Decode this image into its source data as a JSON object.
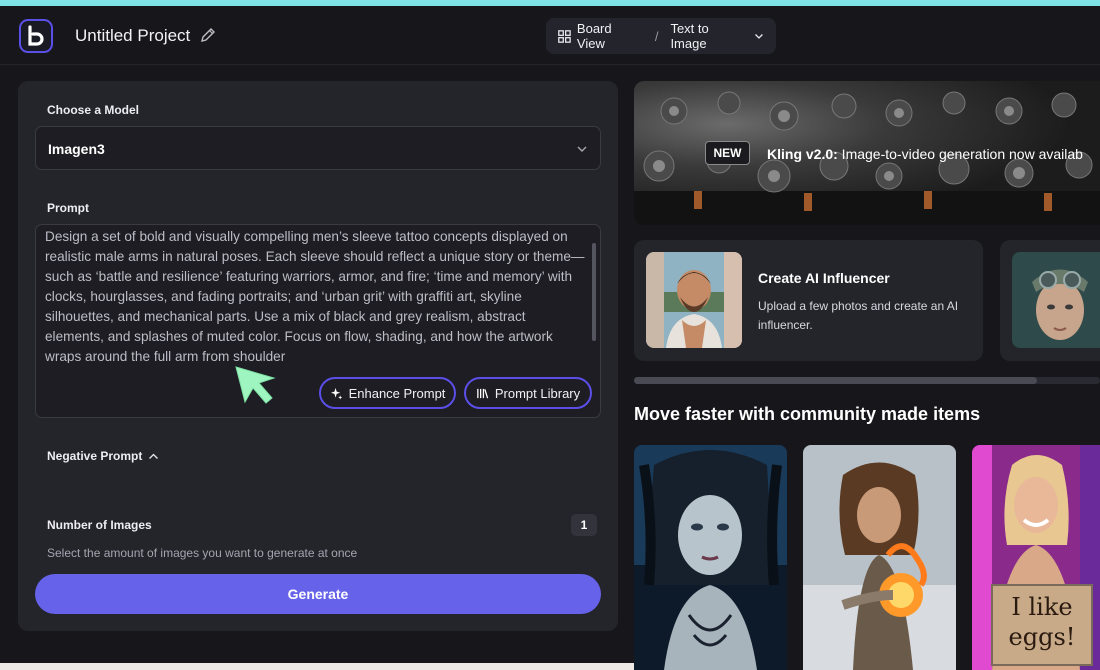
{
  "header": {
    "project_title": "Untitled Project",
    "view_label": "Board View",
    "separator": "/",
    "mode_label": "Text to Image"
  },
  "form": {
    "model_label": "Choose a Model",
    "model_value": "Imagen3",
    "prompt_label": "Prompt",
    "prompt_text": "Design a set of bold and visually compelling men’s sleeve tattoo concepts displayed on realistic male arms in natural poses. Each sleeve should reflect a unique story or theme—such as ‘battle and resilience’ featuring warriors, armor, and fire; ‘time and memory’ with clocks, hourglasses, and fading portraits; and ‘urban grit’ with graffiti art, skyline silhouettes, and mechanical parts. Use a mix of black and grey realism, abstract elements, and splashes of muted color. Focus on flow, shading, and how the artwork wraps around the full arm from shoulder",
    "enhance_label": "Enhance Prompt",
    "library_label": "Prompt Library",
    "negative_label": "Negative Prompt",
    "count_label": "Number of Images",
    "count_value": "1",
    "count_help": "Select the amount of images you want to generate at once",
    "generate_label": "Generate"
  },
  "banner": {
    "badge": "NEW",
    "title": "Kling v2.0:",
    "text": " Image-to-video generation now availab"
  },
  "cards": [
    {
      "title": "Create AI Influencer",
      "desc": "Upload a few photos and create an AI influencer."
    }
  ],
  "community": {
    "title": "Move faster with community made items",
    "tiles": [
      {
        "caption": ""
      },
      {
        "caption": ""
      },
      {
        "caption": "I like eggs!"
      }
    ]
  },
  "colors": {
    "accent": "#6663ea",
    "accent_border": "#5b4fe8",
    "background": "#16161b",
    "panel": "#24242b",
    "cursor": "#8ff0b0"
  },
  "icons": [
    "logo-icon",
    "pencil-icon",
    "grid-icon",
    "chevron-down-icon",
    "sparkle-icon",
    "library-icon",
    "chevron-up-icon",
    "cursor-arrow-icon"
  ]
}
